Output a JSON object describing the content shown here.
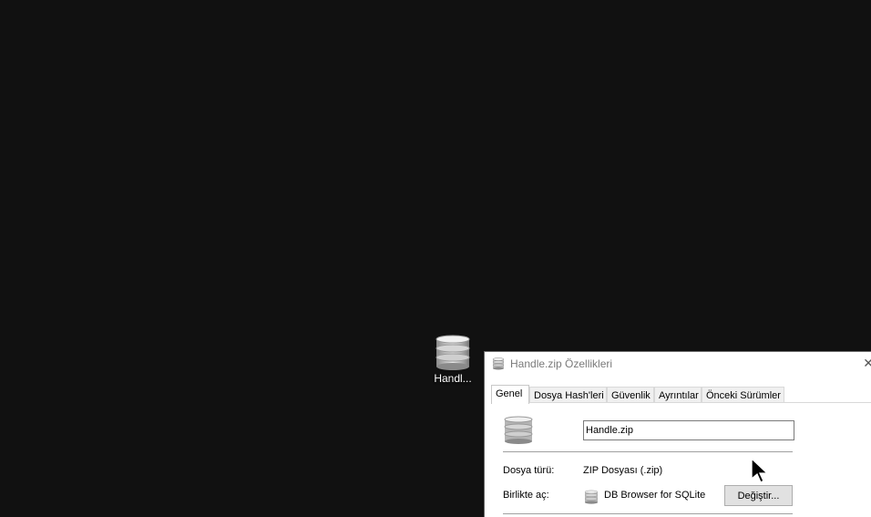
{
  "desktop": {
    "icon_label": "Handl..."
  },
  "dialog": {
    "title": "Handle.zip Özellikleri",
    "close_glyph": "✕",
    "tabs": [
      {
        "label": "Genel",
        "active": true
      },
      {
        "label": "Dosya Hash'leri",
        "active": false
      },
      {
        "label": "Güvenlik",
        "active": false
      },
      {
        "label": "Ayrıntılar",
        "active": false
      },
      {
        "label": "Önceki Sürümler",
        "active": false
      }
    ],
    "general": {
      "file_name": "Handle.zip",
      "file_type_label": "Dosya türü:",
      "file_type_value": "ZIP Dosyası (.zip)",
      "opens_with_label": "Birlikte aç:",
      "opens_with_value": "DB Browser for SQLite",
      "change_button": "Değiştir..."
    }
  },
  "icons": {
    "file_icon": "database-icon",
    "cursor": "mouse-pointer-icon"
  }
}
